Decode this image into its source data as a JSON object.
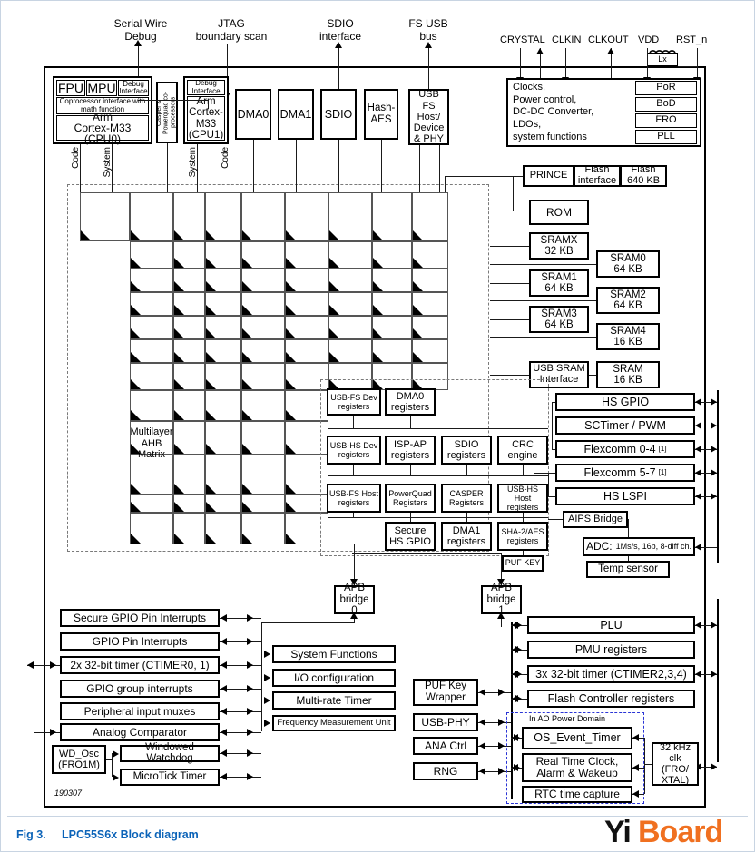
{
  "figure": {
    "number": "Fig 3.",
    "caption": "LPC55S6x Block diagram",
    "doc_id": "190307",
    "watermark_part1": "Yi",
    "watermark_part2": "Board",
    "caption_color": "#0b63b8",
    "watermark_color": "#f07020"
  },
  "top_labels": [
    {
      "id": "swd",
      "line1": "Serial Wire",
      "line2": "Debug"
    },
    {
      "id": "jtag",
      "line1": "JTAG",
      "line2": "boundary scan"
    },
    {
      "id": "sdio",
      "line1": "SDIO",
      "line2": "interface"
    },
    {
      "id": "fsusb",
      "line1": "FS USB",
      "line2": "bus"
    }
  ],
  "pin_labels": [
    {
      "id": "crystal",
      "text": "CRYSTAL"
    },
    {
      "id": "clkin",
      "text": "CLKIN"
    },
    {
      "id": "clkout",
      "text": "CLKOUT"
    },
    {
      "id": "vdd",
      "text": "VDD"
    },
    {
      "id": "rst",
      "text": "RST_n"
    }
  ],
  "inductor": {
    "label": "Lx"
  },
  "cpu0": {
    "fpu": "FPU",
    "mpu": "MPU",
    "debug_interface": "Debug Interface",
    "coprocessor": "Coprocessor interface with math function",
    "core_line1": "Arm",
    "core_line2": "Cortex-M33 (CPU0)",
    "bus_code": "Code",
    "bus_system": "System"
  },
  "coproc": {
    "label": "Casper & Powerquad co-processors"
  },
  "cpu1": {
    "debug_interface": "Debug Interface",
    "core_line1": "Arm",
    "core_line2": "Cortex-",
    "core_line3": "M33",
    "core_line4": "(CPU1)",
    "bus_code": "Code",
    "bus_system": "System"
  },
  "masters": [
    {
      "id": "dma0",
      "label": "DMA0"
    },
    {
      "id": "dma1",
      "label": "DMA1"
    },
    {
      "id": "sdio",
      "label": "SDIO"
    },
    {
      "id": "hash",
      "label": "Hash-AES"
    },
    {
      "id": "usbfs",
      "label": "USB FS Host/ Device & PHY"
    }
  ],
  "clock_block": {
    "lines": [
      "Clocks,",
      "Power control,",
      "DC-DC Converter,",
      "LDOs,",
      "system functions"
    ],
    "sub_blocks": [
      "PoR",
      "BoD",
      "FRO",
      "PLL"
    ]
  },
  "memory": {
    "flash_row": [
      "PRINCE",
      "Flash interface",
      "Flash 640 KB"
    ],
    "rom": "ROM",
    "sram_left": [
      {
        "name": "SRAMX",
        "size": "32 KB"
      },
      {
        "name": "SRAM1",
        "size": "64 KB"
      },
      {
        "name": "SRAM3",
        "size": "64 KB"
      }
    ],
    "sram_right": [
      {
        "name": "SRAM0",
        "size": "64 KB"
      },
      {
        "name": "SRAM2",
        "size": "64 KB"
      },
      {
        "name": "SRAM4",
        "size": "16 KB"
      }
    ],
    "usb_sram_interface": "USB SRAM Interface",
    "usb_sram": {
      "name": "SRAM",
      "size": "16 KB"
    }
  },
  "matrix": {
    "label_line1": "Multilayer",
    "label_line2": "AHB Matrix"
  },
  "registers": {
    "row1": [
      {
        "id": "usbfs-dev",
        "line1": "USB-FS  Dev",
        "line2": "registers"
      },
      {
        "id": "dma0-reg",
        "line1": "DMA0",
        "line2": "registers"
      }
    ],
    "row2": [
      {
        "id": "usbhs-dev",
        "line1": "USB-HS Dev",
        "line2": "registers"
      },
      {
        "id": "isp-ap",
        "line1": "ISP-AP",
        "line2": "registers"
      },
      {
        "id": "sdio-reg",
        "line1": "SDIO",
        "line2": "registers"
      },
      {
        "id": "crc",
        "line1": "CRC",
        "line2": "engine"
      }
    ],
    "row3": [
      {
        "id": "usbfs-host",
        "line1": "USB-FS Host",
        "line2": "registers"
      },
      {
        "id": "powerquad",
        "line1": "PowerQuad",
        "line2": "Registers"
      },
      {
        "id": "casper",
        "line1": "CASPER",
        "line2": "Registers"
      },
      {
        "id": "usbhs-host",
        "line1": "USB-HS Host",
        "line2": "registers"
      }
    ],
    "row4": [
      {
        "id": "secure-hs-gpio",
        "line1": "Secure",
        "line2": "HS GPIO"
      },
      {
        "id": "dma1-reg",
        "line1": "DMA1",
        "line2": "registers"
      },
      {
        "id": "sha2aes",
        "line1": "SHA-2/AES",
        "line2": "registers"
      }
    ],
    "puf_key": "PUF KEY"
  },
  "right_peripherals": [
    {
      "id": "hs-gpio",
      "label": "HS GPIO",
      "note": ""
    },
    {
      "id": "sctimer",
      "label": "SCTimer / PWM",
      "note": ""
    },
    {
      "id": "flexcomm04",
      "label": "Flexcomm 0-4",
      "note": "[1]"
    },
    {
      "id": "flexcomm57",
      "label": "Flexcomm 5-7",
      "note": "[1]"
    },
    {
      "id": "hs-lspi",
      "label": "HS LSPI",
      "note": ""
    }
  ],
  "aips": {
    "bridge": "AIPS Bridge",
    "adc_prefix": "ADC:",
    "adc_spec": "1Ms/s, 16b, 8-diff ch.",
    "temp_sensor": "Temp sensor"
  },
  "bridges": [
    {
      "id": "apb0",
      "line1": "APB",
      "line2": "bridge 0"
    },
    {
      "id": "apb1",
      "line1": "APB",
      "line2": "bridge 1"
    }
  ],
  "left_peripherals": [
    {
      "id": "secure-gpio-pin-int",
      "label": "Secure GPIO Pin Interrupts"
    },
    {
      "id": "gpio-pin-int",
      "label": "GPIO Pin Interrupts"
    },
    {
      "id": "ctimer01",
      "label": "2x 32-bit timer (CTIMER0, 1)"
    },
    {
      "id": "gpio-group-int",
      "label": "GPIO group interrupts"
    },
    {
      "id": "periph-input-muxes",
      "label": "Peripheral input muxes"
    },
    {
      "id": "analog-comparator",
      "label": "Analog Comparator"
    }
  ],
  "watchdog": {
    "osc_line1": "WD_Osc",
    "osc_line2": "(FRO1M)",
    "windowed": "Windowed Watchdog",
    "microtick": "MicroTick Timer"
  },
  "apb0_peripherals": [
    {
      "id": "system-functions",
      "label": "System Functions"
    },
    {
      "id": "io-configuration",
      "label": "I/O configuration"
    },
    {
      "id": "multi-rate-timer",
      "label": "Multi-rate Timer"
    },
    {
      "id": "freq-measure-unit",
      "label": "Frequency Measurement Unit"
    }
  ],
  "apb1_mid_peripherals": [
    {
      "id": "puf-key-wrapper",
      "line1": "PUF Key",
      "line2": "Wrapper"
    },
    {
      "id": "usb-phy",
      "line1": "USB-PHY",
      "line2": ""
    },
    {
      "id": "ana-ctrl",
      "line1": "ANA Ctrl",
      "line2": ""
    },
    {
      "id": "rng",
      "line1": "RNG",
      "line2": ""
    }
  ],
  "apb1_peripherals": [
    {
      "id": "plu",
      "label": "PLU"
    },
    {
      "id": "pmu-registers",
      "label": "PMU registers"
    },
    {
      "id": "ctimer234",
      "label": "3x 32-bit timer (CTIMER2,3,4)"
    },
    {
      "id": "flash-ctrl-reg",
      "label": "Flash Controller registers"
    }
  ],
  "ao_domain": {
    "title": "In AO Power Domain",
    "border_color": "#2b35d6",
    "blocks": [
      {
        "id": "os-event-timer",
        "line1": "OS_Event_Timer",
        "line2": ""
      },
      {
        "id": "rtc",
        "line1": "Real Time Clock,",
        "line2": "Alarm & Wakeup"
      },
      {
        "id": "rtc-capture",
        "line1": "RTC time capture",
        "line2": ""
      }
    ]
  },
  "clk32k": {
    "line1": "32 kHz",
    "line2": "clk (FRO/",
    "line3": "XTAL)"
  }
}
